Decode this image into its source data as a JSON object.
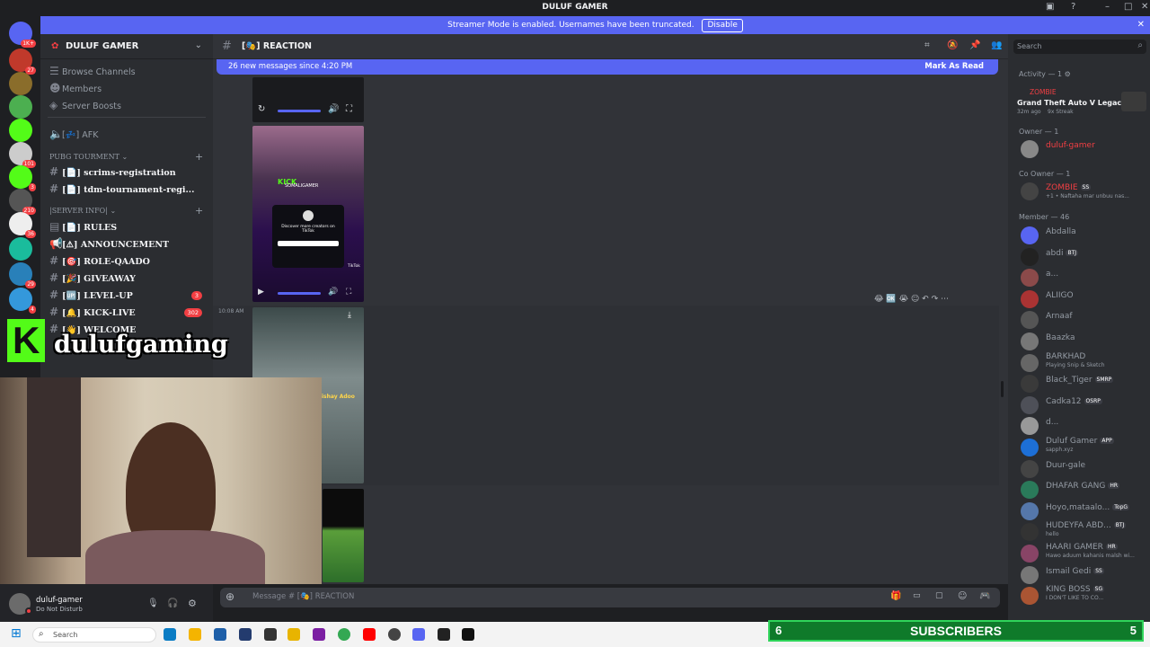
{
  "window": {
    "title": "DULUF GAMER"
  },
  "banner": {
    "text": "Streamer Mode is enabled. Usernames have been truncated.",
    "button": "Disable"
  },
  "server_badges": [
    "1K+",
    "27",
    "101",
    "3",
    "210",
    "36",
    "29",
    "4"
  ],
  "server": {
    "name": "DULUF GAMER"
  },
  "sidebar": {
    "top_items": [
      "Browse Channels",
      "Members",
      "Server Boosts"
    ],
    "afk": "AFK",
    "categories": {
      "pubg": "PUBG TOURMENT",
      "info": "|SERVER INFO|"
    },
    "pubg_channels": [
      "scrims-registration",
      "tdm-tournament-regi..."
    ],
    "info_channels": [
      {
        "name": "RULES",
        "count": ""
      },
      {
        "name": "ANNOUNCEMENT",
        "count": ""
      },
      {
        "name": "ROLE-QAADO",
        "count": ""
      },
      {
        "name": "GIVEAWAY",
        "count": ""
      },
      {
        "name": "LEVEL-UP",
        "count": "3"
      },
      {
        "name": "KICK-LIVE",
        "count": "302"
      },
      {
        "name": "WELCOME",
        "count": ""
      }
    ]
  },
  "overlay": {
    "kick_handle": "dulufgaming",
    "kick_letter": "K"
  },
  "chat": {
    "channel": "REACTION",
    "new_messages": "26 new messages since 4:20 PM",
    "mark_read": "Mark As Read",
    "timestamp": "10:08 AM",
    "media_text": {
      "kick": "KICK",
      "somali": "SOMALIGAMER",
      "discover": "Discover more creators on TikTok",
      "tiktok": "TikTok",
      "shaay": "Dishay Adoo"
    },
    "composer_placeholder": "Message #  [🎭]  REACTION"
  },
  "user": {
    "name": "duluf-gamer",
    "status": "Do Not Disturb"
  },
  "search": {
    "placeholder": "Search"
  },
  "members": {
    "activity_header": "Activity — 1",
    "activity": {
      "name": "ZOMBIE",
      "game": "Grand Theft Auto V Legacy",
      "time": "32m ago",
      "streak": "9x Streak"
    },
    "owner_header": "Owner — 1",
    "owner": {
      "name": "duluf-gamer"
    },
    "coowner_header": "Co Owner — 1",
    "coowner": {
      "name": "ZOMBIE",
      "tag": "SS",
      "sub": "+1 • Naftaha mar unbuu nas..."
    },
    "member_header": "Member — 46",
    "list": [
      {
        "name": "Abdalla",
        "tag": "",
        "sub": ""
      },
      {
        "name": "abdi",
        "tag": "BTJ",
        "sub": ""
      },
      {
        "name": "a...",
        "tag": "",
        "sub": ""
      },
      {
        "name": "ALIIGO",
        "tag": "",
        "sub": ""
      },
      {
        "name": "Arnaaf",
        "tag": "",
        "sub": ""
      },
      {
        "name": "Baazka",
        "tag": "",
        "sub": ""
      },
      {
        "name": "BARKHAD",
        "tag": "",
        "sub": "Playing Snip & Sketch"
      },
      {
        "name": "Black_Tiger",
        "tag": "SMRP",
        "sub": ""
      },
      {
        "name": "Cadka12",
        "tag": "OSRP",
        "sub": ""
      },
      {
        "name": "d...",
        "tag": "",
        "sub": ""
      },
      {
        "name": "Duluf Gamer",
        "tag": "APP",
        "sub": "sapph.xyz"
      },
      {
        "name": "Duur-gale",
        "tag": "",
        "sub": ""
      },
      {
        "name": "DHAFAR GANG",
        "tag": "HR",
        "sub": ""
      },
      {
        "name": "Hoyo,mataalo...",
        "tag": "TopG",
        "sub": ""
      },
      {
        "name": "HUDEYFA ABD...",
        "tag": "BTJ",
        "sub": "hello"
      },
      {
        "name": "HAARI GAMER",
        "tag": "HR",
        "sub": "Hawo aduum kahanis malsh wi..."
      },
      {
        "name": "Ismail Gedi",
        "tag": "SS",
        "sub": ""
      },
      {
        "name": "KING BOSS",
        "tag": "SG",
        "sub": "I DON'T LIKE TO CO..."
      }
    ]
  },
  "taskbar": {
    "search": "Search"
  },
  "subscribers": {
    "left": "6",
    "label": "SUBSCRIBERS",
    "right": "5"
  },
  "colors": {
    "blurple": "#5865f2",
    "bg": "#313338",
    "sidebar": "#2b2d31",
    "red": "#f23f43",
    "green": "#23a55a"
  }
}
